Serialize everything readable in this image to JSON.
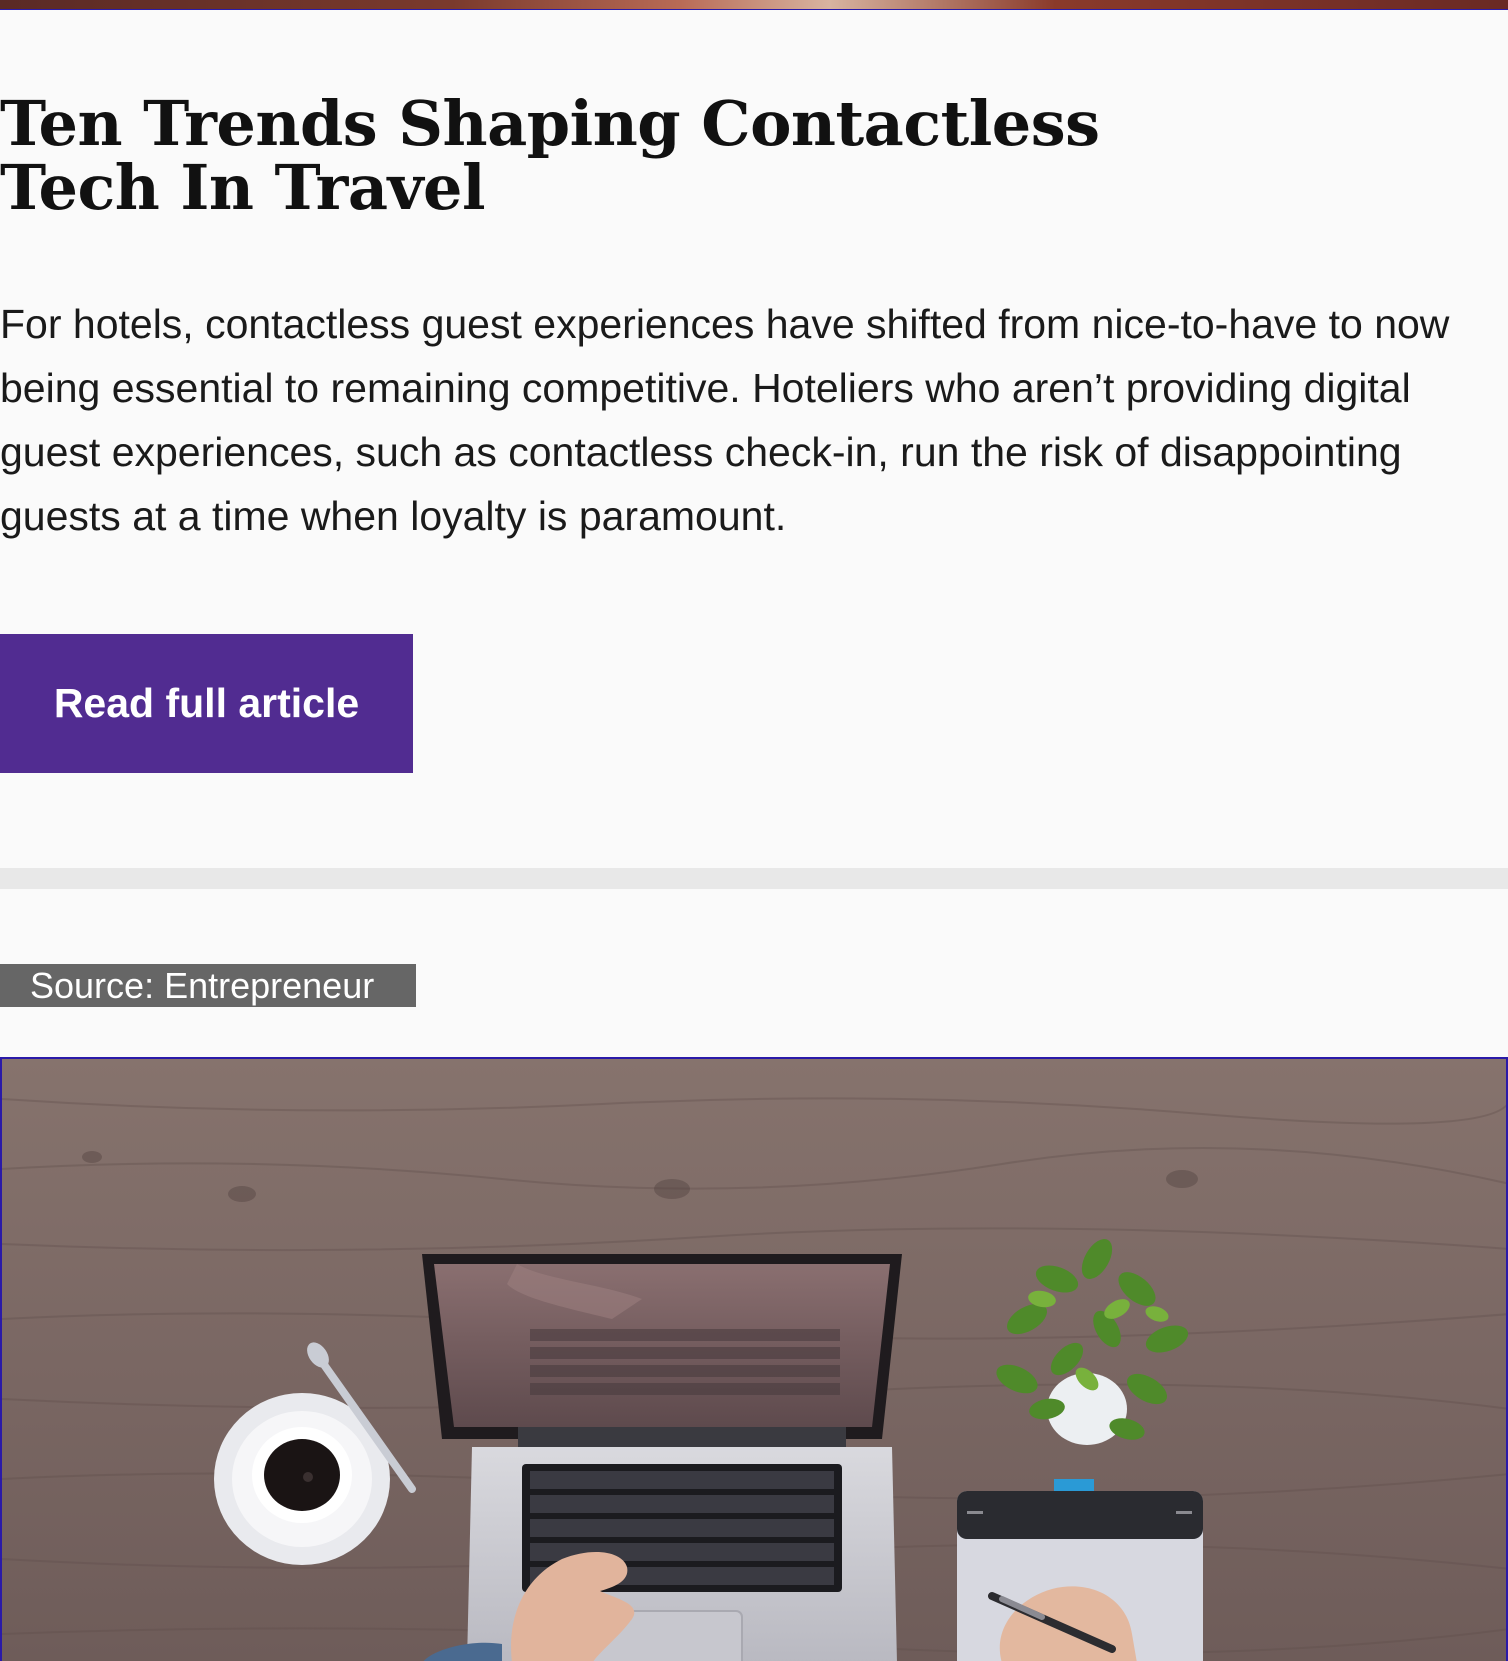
{
  "article": {
    "title_line1": "Ten Trends Shaping Contactless",
    "title_line2": "Tech In Travel",
    "summary": "For hotels, contactless guest experiences have shifted from nice-to-have to now being essential to remaining competitive. Hoteliers who aren’t providing digital guest experiences, such as contactless check-in, run the risk of disappointing guests at a time when loyalty is paramount.",
    "read_button_label": "Read full article"
  },
  "next_article": {
    "source_label": "Source: Entrepreneur",
    "image": "laptop-on-wooden-desk-photo"
  },
  "colors": {
    "button": "#512c91",
    "badge": "#666666",
    "divider": "#e8e8e8",
    "background": "#fafafa"
  }
}
